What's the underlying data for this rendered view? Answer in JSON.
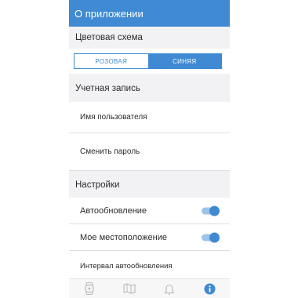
{
  "header": {
    "title": "О приложении"
  },
  "color_scheme": {
    "title": "Цветовая схема",
    "options": [
      "РОЗОВАЯ",
      "СИНЯЯ"
    ],
    "selected": "СИНЯЯ"
  },
  "account": {
    "title": "Учетная запись",
    "items": [
      "Имя пользователя",
      "Сменить пароль"
    ]
  },
  "settings": {
    "title": "Настройки",
    "items": [
      {
        "label": "Автообновление",
        "enabled": true
      },
      {
        "label": "Мое местоположение",
        "enabled": true
      },
      {
        "label": "Интервал автообновления"
      }
    ]
  },
  "tabbar": {
    "tabs": [
      "watch-icon",
      "map-icon",
      "bell-icon",
      "info-icon"
    ],
    "active": "info-icon"
  },
  "colors": {
    "accent": "#3f8ad3",
    "toggle_track": "#9ec3ea"
  }
}
